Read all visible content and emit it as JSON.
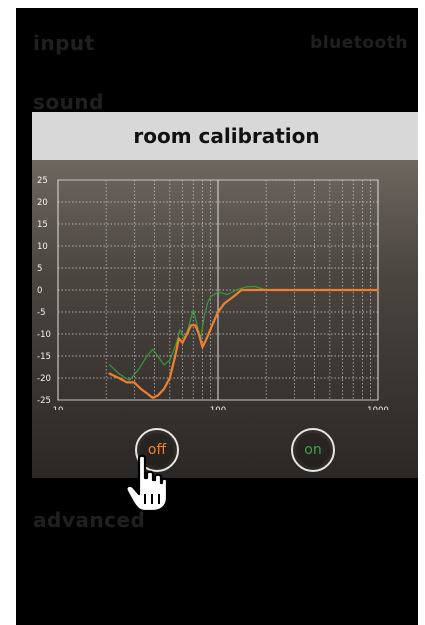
{
  "menu": {
    "input": "input",
    "bluetooth": "bluetooth",
    "sound": "sound",
    "advanced": "advanced"
  },
  "dialog": {
    "title": "room calibration",
    "off_label": "off",
    "on_label": "on"
  },
  "colors": {
    "off_curve": "#f08030",
    "on_curve": "#3a9a3a"
  },
  "chart_data": {
    "type": "line",
    "x_scale": "log",
    "xlim": [
      10,
      1000
    ],
    "ylim": [
      -25,
      25
    ],
    "x_ticks": [
      "10",
      "100",
      "1000"
    ],
    "y_ticks": [
      "25",
      "20",
      "15",
      "10",
      "5",
      "0",
      "-5",
      "-10",
      "-15",
      "-20",
      "-25"
    ],
    "grid": true,
    "series": [
      {
        "color": "#3a9a3a",
        "points": [
          [
            21,
            -17
          ],
          [
            24,
            -19
          ],
          [
            28,
            -20.5
          ],
          [
            32,
            -18
          ],
          [
            36,
            -15
          ],
          [
            39,
            -13.5
          ],
          [
            42,
            -15
          ],
          [
            46,
            -17
          ],
          [
            50,
            -16
          ],
          [
            55,
            -12
          ],
          [
            58,
            -9
          ],
          [
            62,
            -11
          ],
          [
            66,
            -8
          ],
          [
            70,
            -4.5
          ],
          [
            74,
            -8
          ],
          [
            78,
            -11
          ],
          [
            82,
            -6
          ],
          [
            86,
            -3
          ],
          [
            90,
            -1.5
          ],
          [
            100,
            -0.5
          ],
          [
            115,
            -1
          ],
          [
            130,
            0
          ],
          [
            150,
            0.7
          ],
          [
            170,
            0.8
          ],
          [
            200,
            0
          ],
          [
            1000,
            0
          ]
        ]
      },
      {
        "color": "#f08030",
        "points": [
          [
            21,
            -19
          ],
          [
            24,
            -20
          ],
          [
            27,
            -21
          ],
          [
            30,
            -21
          ],
          [
            33,
            -22.5
          ],
          [
            36,
            -23.5
          ],
          [
            39,
            -24.5
          ],
          [
            42,
            -24
          ],
          [
            46,
            -22.5
          ],
          [
            50,
            -20
          ],
          [
            54,
            -15
          ],
          [
            57,
            -11
          ],
          [
            60,
            -12
          ],
          [
            64,
            -10
          ],
          [
            68,
            -8
          ],
          [
            72,
            -8
          ],
          [
            76,
            -10
          ],
          [
            80,
            -13
          ],
          [
            85,
            -11
          ],
          [
            92,
            -8
          ],
          [
            100,
            -5
          ],
          [
            110,
            -3
          ],
          [
            125,
            -1.5
          ],
          [
            140,
            0
          ],
          [
            170,
            0
          ],
          [
            250,
            0
          ],
          [
            1000,
            0
          ]
        ]
      }
    ]
  }
}
